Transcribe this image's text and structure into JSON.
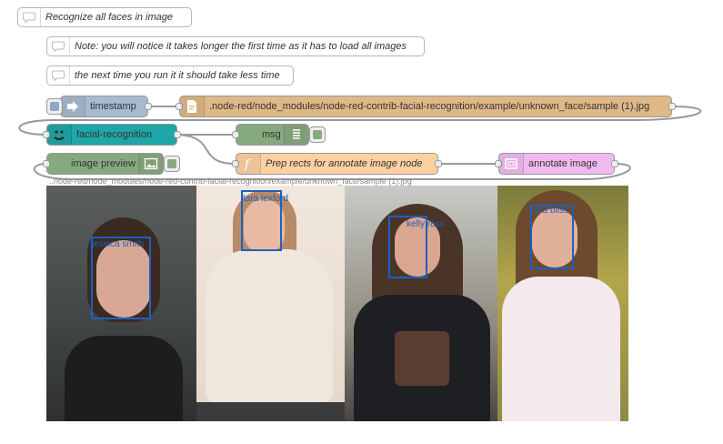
{
  "comments": [
    {
      "id": "c1",
      "text": "Recognize all faces in image"
    },
    {
      "id": "c2",
      "text": "Note: you will notice it takes longer the first time as it has to load all images"
    },
    {
      "id": "c3",
      "text": "the next time you run it it should take less time"
    }
  ],
  "nodes": {
    "inject": {
      "label": "timestamp",
      "color": "#a6bbcf",
      "icon": "arrow-in-icon"
    },
    "file": {
      "label": ".node-red/node_modules/node-red-contrib-facial-recognition/example/unknown_face/sample (1).jpg",
      "color": "#deb887",
      "icon": "file-icon"
    },
    "recog": {
      "label": "facial-recognition",
      "color": "#1fa6a6",
      "icon": "face-icon"
    },
    "debug": {
      "label": "msg",
      "color": "#87a980",
      "icon": "debug-list-icon"
    },
    "func": {
      "label": "Prep rects for annotate image node",
      "color": "#fdd0a2",
      "icon": "function-icon"
    },
    "annotate": {
      "label": "annotate image",
      "color": "#f0b9f0",
      "icon": "annotate-icon"
    },
    "preview": {
      "label": "image preview",
      "color": "#87a980",
      "icon": "image-icon"
    }
  },
  "preview": {
    "filename": "..node-red/node_modules/node-red-contrib-facial-recognition/example/unknown_face/sample (1).jpg",
    "faces": [
      {
        "name": "jessica smith"
      },
      {
        "name": "tara lexford"
      },
      {
        "name": "kelly ross"
      },
      {
        "name": "ava bliss"
      }
    ]
  },
  "colors": {
    "wire": "#999999",
    "facebox": "#1f5fc0"
  }
}
